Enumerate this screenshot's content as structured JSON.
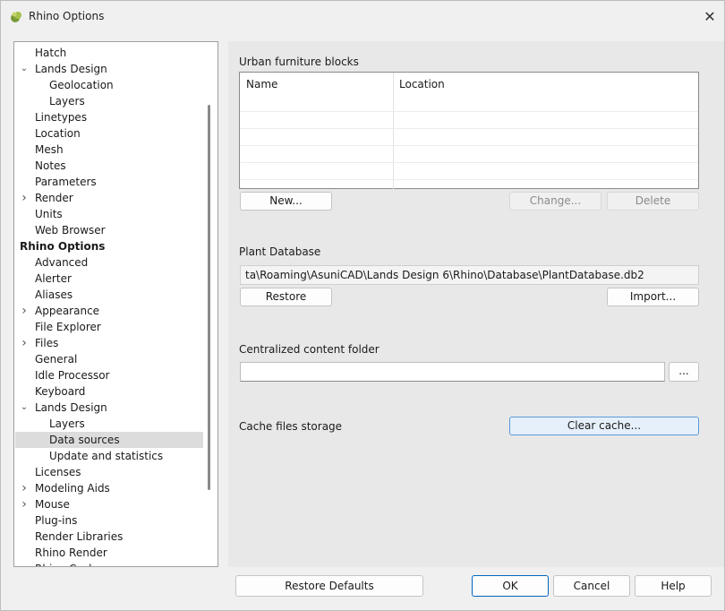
{
  "window": {
    "title": "Rhino Options",
    "close_glyph": "✕"
  },
  "tree": {
    "items": [
      {
        "label": "Hatch",
        "indent": 1
      },
      {
        "label": "Lands Design",
        "indent": 1,
        "chevron": "expanded"
      },
      {
        "label": "Geolocation",
        "indent": 2
      },
      {
        "label": "Layers",
        "indent": 2
      },
      {
        "label": "Linetypes",
        "indent": 1
      },
      {
        "label": "Location",
        "indent": 1
      },
      {
        "label": "Mesh",
        "indent": 1
      },
      {
        "label": "Notes",
        "indent": 1
      },
      {
        "label": "Parameters",
        "indent": 1
      },
      {
        "label": "Render",
        "indent": 1,
        "chevron": "collapsed"
      },
      {
        "label": "Units",
        "indent": 1
      },
      {
        "label": "Web Browser",
        "indent": 1
      },
      {
        "label": "Rhino Options",
        "indent": 0,
        "bold": true
      },
      {
        "label": "Advanced",
        "indent": 1
      },
      {
        "label": "Alerter",
        "indent": 1
      },
      {
        "label": "Aliases",
        "indent": 1
      },
      {
        "label": "Appearance",
        "indent": 1,
        "chevron": "collapsed"
      },
      {
        "label": "File Explorer",
        "indent": 1
      },
      {
        "label": "Files",
        "indent": 1,
        "chevron": "collapsed"
      },
      {
        "label": "General",
        "indent": 1
      },
      {
        "label": "Idle Processor",
        "indent": 1
      },
      {
        "label": "Keyboard",
        "indent": 1
      },
      {
        "label": "Lands Design",
        "indent": 1,
        "chevron": "expanded"
      },
      {
        "label": "Layers",
        "indent": 2
      },
      {
        "label": "Data sources",
        "indent": 2,
        "selected": true
      },
      {
        "label": "Update and statistics",
        "indent": 2
      },
      {
        "label": "Licenses",
        "indent": 1
      },
      {
        "label": "Modeling Aids",
        "indent": 1,
        "chevron": "collapsed"
      },
      {
        "label": "Mouse",
        "indent": 1,
        "chevron": "collapsed"
      },
      {
        "label": "Plug-ins",
        "indent": 1
      },
      {
        "label": "Render Libraries",
        "indent": 1
      },
      {
        "label": "Rhino Render",
        "indent": 1
      },
      {
        "label": "Rhino Cycles",
        "indent": 1
      }
    ]
  },
  "urban": {
    "title": "Urban furniture blocks",
    "col_name": "Name",
    "col_location": "Location",
    "new_label": "New...",
    "change_label": "Change...",
    "delete_label": "Delete"
  },
  "plant": {
    "title": "Plant Database",
    "path": "ta\\Roaming\\AsuniCAD\\Lands Design 6\\Rhino\\Database\\PlantDatabase.db2",
    "restore_label": "Restore",
    "import_label": "Import..."
  },
  "central": {
    "title": "Centralized content folder",
    "value": "",
    "browse_label": "..."
  },
  "cache": {
    "title": "Cache files storage",
    "clear_label": "Clear cache..."
  },
  "footer": {
    "restore_defaults": "Restore Defaults",
    "ok": "OK",
    "cancel": "Cancel",
    "help": "Help"
  },
  "colors": {
    "selection": "#dcdcdc",
    "accent": "#0067c0"
  }
}
